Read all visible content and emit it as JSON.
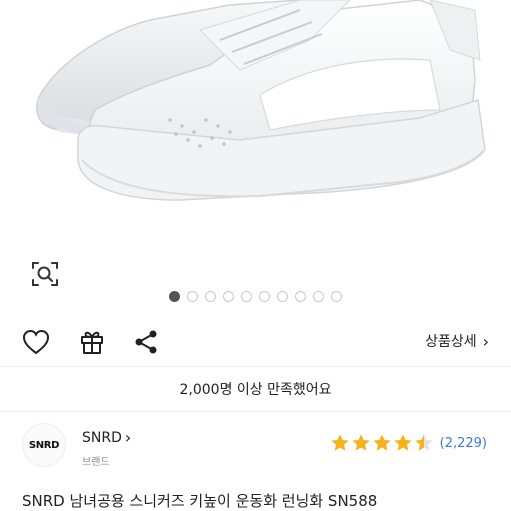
{
  "image": {
    "alt": "white sneakers"
  },
  "pager": {
    "total": 10,
    "active_index": 0
  },
  "actions": {
    "detail_label": "상품상세",
    "detail_chevron": "›"
  },
  "satisfaction_text": "2,000명 이상 만족했어요",
  "brand": {
    "logo_text": "SNRD",
    "name": "SNRD",
    "chevron": "›",
    "sub_label": "브랜드"
  },
  "rating": {
    "stars": 4.5,
    "count_text": "(2,229)",
    "star_color": "#f6b21a",
    "star_empty_color": "#e2e2e2"
  },
  "product_title": "SNRD 남녀공용 스니커즈 키높이 운동화 런닝화 SN588",
  "colors": {
    "link": "#3b7bd8"
  }
}
